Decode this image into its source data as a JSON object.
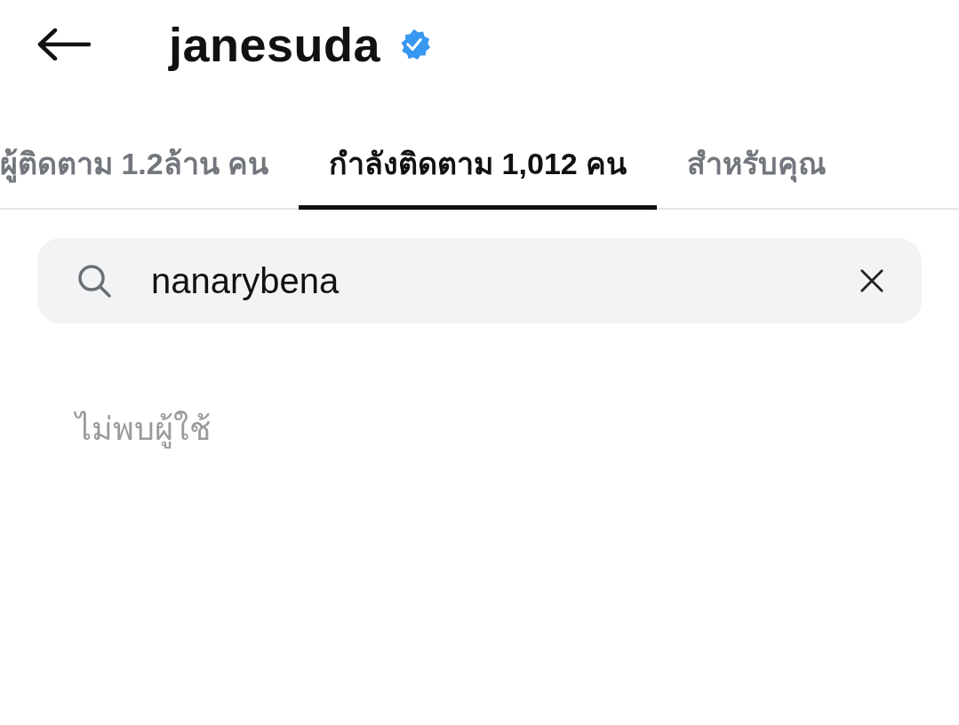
{
  "header": {
    "title": "janesuda",
    "verified": true
  },
  "tabs": [
    {
      "label": "ผู้ติดตาม 1.2ล้าน คน",
      "selected": false
    },
    {
      "label": "กำลังติดตาม 1,012 คน",
      "selected": true
    },
    {
      "label": "สำหรับคุณ",
      "selected": false
    }
  ],
  "search": {
    "value": "nanarybena"
  },
  "empty_message": "ไม่พบผู้ใช้"
}
